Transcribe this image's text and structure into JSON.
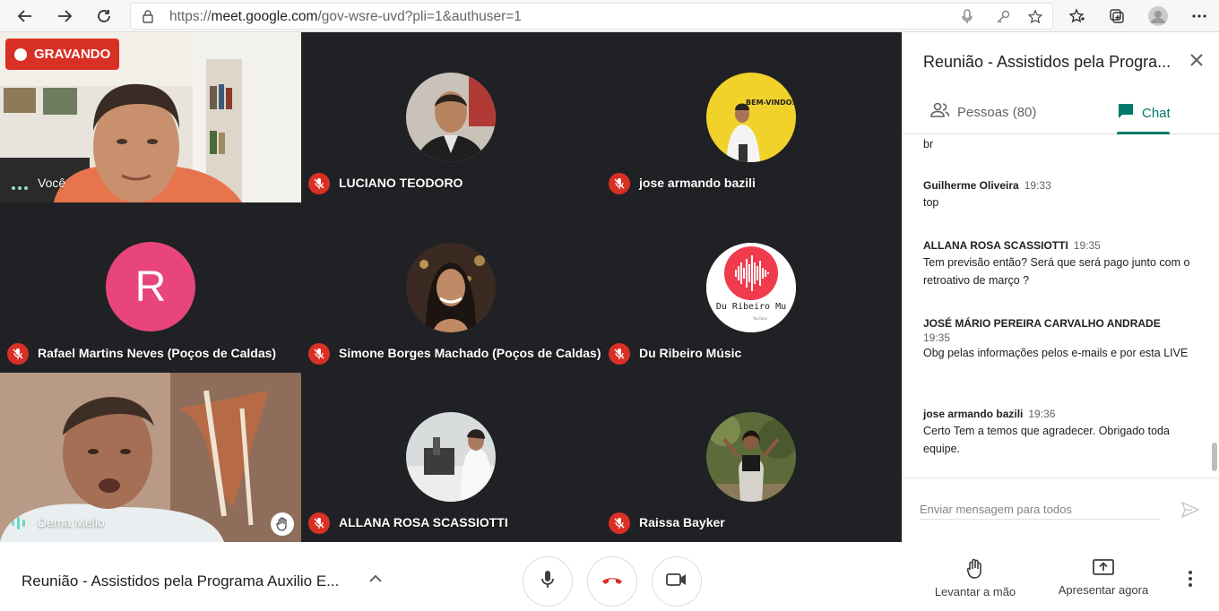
{
  "browser": {
    "url_prefix": "https://",
    "url_domain": "meet.google.com",
    "url_path": "/gov-wsre-uvd?pli=1&authuser=1"
  },
  "recording": {
    "label": "GRAVANDO"
  },
  "tiles": [
    {
      "name": "Você"
    },
    {
      "name": "LUCIANO TEODORO"
    },
    {
      "name": "jose armando bazili"
    },
    {
      "name": "Rafael Martins Neves (Poços de Caldas)",
      "initial": "R"
    },
    {
      "name": "Simone Borges Machado (Poços de Caldas)"
    },
    {
      "name": "Du Ribeiro Músic",
      "logo_text": "Du Ribeiro Mu",
      "logo_sub": "YouTube"
    },
    {
      "name": "Dema Mello"
    },
    {
      "name": "ALLANA ROSA SCASSIOTTI"
    },
    {
      "name": "Raissa Bayker"
    }
  ],
  "banner_text": "BEM-VINDOS",
  "panel": {
    "title": "Reunião - Assistidos pela Progra...",
    "tab_people": "Pessoas (80)",
    "tab_chat": "Chat",
    "messages": [
      {
        "author": "",
        "time": "",
        "text": "br"
      },
      {
        "author": "Guilherme Oliveira",
        "time": "19:33",
        "text": "top"
      },
      {
        "author": "ALLANA ROSA SCASSIOTTI",
        "time": "19:35",
        "text": "Tem previsão então? Será que será pago junto com o retroativo de março ?"
      },
      {
        "author": "JOSÉ MÁRIO PEREIRA CARVALHO ANDRADE",
        "time": "19:35",
        "text": "Obg pelas informações pelos e-mails e por esta LIVE"
      },
      {
        "author": "jose armando bazili",
        "time": "19:36",
        "text": "Certo Tem a temos que agradecer. Obrigado toda equipe."
      }
    ],
    "compose_placeholder": "Enviar mensagem para todos"
  },
  "bottom": {
    "meeting_name": "Reunião - Assistidos pela Programa Auxilio E...",
    "raise_hand": "Levantar a mão",
    "present": "Apresentar agora"
  },
  "colors": {
    "accent": "#00796b",
    "red": "#d93025",
    "grid_bg": "#202124",
    "avatar_r": "#e8457a"
  }
}
